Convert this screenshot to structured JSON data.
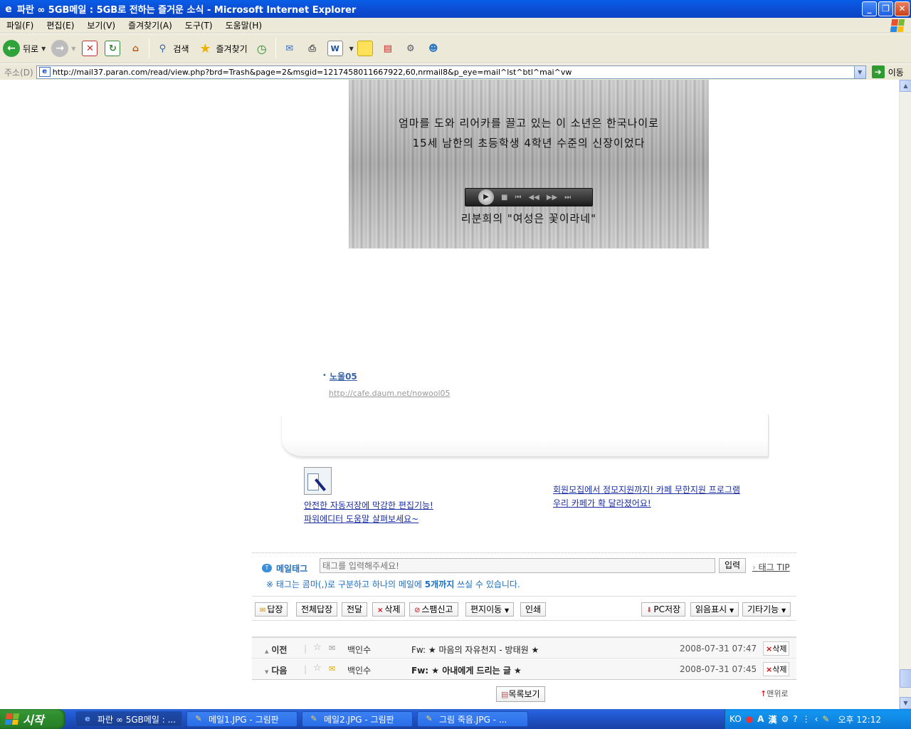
{
  "window": {
    "title": "파란 ∞ 5GB메일 : 5GB로 전하는 즐거운 소식 - Microsoft Internet Explorer",
    "buttons": {
      "minimize": "_",
      "restore": "❐",
      "close": "✕"
    }
  },
  "menu": [
    "파일(F)",
    "편집(E)",
    "보기(V)",
    "즐겨찾기(A)",
    "도구(T)",
    "도움말(H)"
  ],
  "toolbar": {
    "back": "뒤로",
    "search": "검색",
    "favorites": "즐겨찾기"
  },
  "address": {
    "label": "주소(D)",
    "url": "http://mail37.paran.com/read/view.php?brd=Trash&page=2&msgid=1217458011667922,60,nrmail8&p_eye=mail^lst^btl^mai^vw",
    "go": "이동"
  },
  "video": {
    "line1": "엄마를 도와 리어카를 끌고 있는 이 소년은 한국나이로",
    "line2": "15세 남한의 초등학생 4학년 수준의 신장이었다",
    "caption": "리분희의 \"여성은 꽃이라네\""
  },
  "signature": {
    "name": "노울05",
    "url": "http://cafe.daum.net/nowool05"
  },
  "ads": {
    "left_line1": "안전한 자동저장에 막강한 편집기능!",
    "left_line2": "파워에디터 도움말 살펴보세요~",
    "right_line1": "회원모집에서 정모지원까지! 카페 무한지원 프로그램",
    "right_line2": "우리 카페가 확 달라졌어요!"
  },
  "tags": {
    "label": "메일태그",
    "placeholder": "태그를 입력해주세요!",
    "submit": "입력",
    "tip": "태그 TIP",
    "note_prefix": "※ 태그는 콤마(,)로 구분하고 하나의 메일에 ",
    "note_bold": "5개까지",
    "note_suffix": " 쓰실 수 있습니다."
  },
  "actions": {
    "reply": "답장",
    "reply_all": "전체답장",
    "forward": "전달",
    "delete": "삭제",
    "spam": "스팸신고",
    "move": "편지이동",
    "print": "인쇄",
    "pc_save": "PC저장",
    "read_mark": "읽음표시",
    "other": "기타기능"
  },
  "nav": [
    {
      "dir": "이전",
      "sender": "백인수",
      "subject": "Fw: ★ 마음의 자유천지 - 방태원 ★",
      "date": "2008-07-31 07:47",
      "delete": "삭제"
    },
    {
      "dir": "다음",
      "sender": "백인수",
      "subject": "Fw: ★ 아내에게 드리는 글 ★",
      "date": "2008-07-31 07:45",
      "delete": "삭제"
    }
  ],
  "list_button": "목록보기",
  "to_top": "맨위로",
  "taskbar": {
    "start": "시작",
    "tasks": [
      "파란 ∞ 5GB메일 : ...",
      "메일1.JPG - 그림판",
      "메일2.JPG - 그림판",
      "그림 죽음.JPG - ..."
    ],
    "lang": "KO",
    "clock": "오후 12:12"
  },
  "colors": {
    "title_bar": "#0b4fd6",
    "link": "#1b2ea6",
    "tag_blue": "#1e6fbf",
    "taskbar": "#245edb",
    "start_green": "#2f8f2f"
  }
}
